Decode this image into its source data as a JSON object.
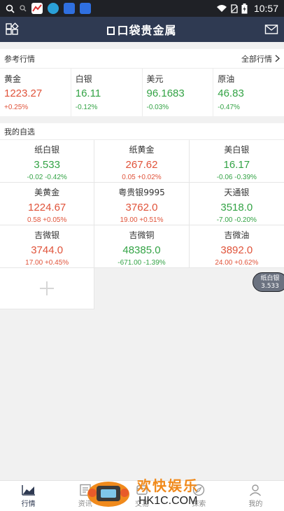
{
  "status_bar": {
    "time": "10:57",
    "left_icons": [
      "search-icon",
      "search-small-icon",
      "stock-app-icon",
      "browser-app-icon",
      "baidu-app-icon",
      "baidu-app-icon"
    ],
    "right_icons": [
      "wifi-icon",
      "no-sim-icon",
      "battery-icon"
    ]
  },
  "app_bar": {
    "title": "口袋贵金属",
    "left_icon": "grid-icon",
    "right_icon": "mail-icon",
    "background": "#2f3a52"
  },
  "reference": {
    "section_title": "参考行情",
    "all_link": "全部行情",
    "items": [
      {
        "name": "黄金",
        "price": "1223.27",
        "change": "+0.25%",
        "direction": "up"
      },
      {
        "name": "白银",
        "price": "16.11",
        "change": "-0.12%",
        "direction": "down"
      },
      {
        "name": "美元",
        "price": "96.1683",
        "change": "-0.03%",
        "direction": "down"
      },
      {
        "name": "原油",
        "price": "46.83",
        "change": "-0.47%",
        "direction": "down"
      }
    ]
  },
  "watchlist": {
    "section_title": "我的自选",
    "rows": [
      [
        {
          "name": "纸白银",
          "price": "3.533",
          "change": "-0.02  -0.42%",
          "direction": "down"
        },
        {
          "name": "纸黄金",
          "price": "267.62",
          "change": "0.05  +0.02%",
          "direction": "up"
        },
        {
          "name": "美白银",
          "price": "16.17",
          "change": "-0.06  -0.39%",
          "direction": "down"
        }
      ],
      [
        {
          "name": "美黄金",
          "price": "1224.67",
          "change": "0.58  +0.05%",
          "direction": "up"
        },
        {
          "name": "粤贵银9995",
          "price": "3762.0",
          "change": "19.00  +0.51%",
          "direction": "up"
        },
        {
          "name": "天通银",
          "price": "3518.0",
          "change": "-7.00  -0.20%",
          "direction": "down"
        }
      ],
      [
        {
          "name": "吉微银",
          "price": "3744.0",
          "change": "17.00  +0.45%",
          "direction": "up"
        },
        {
          "name": "吉微铜",
          "price": "48385.0",
          "change": "-671.00  -1.39%",
          "direction": "down"
        },
        {
          "name": "吉微油",
          "price": "3892.0",
          "change": "24.00  +0.62%",
          "direction": "up"
        }
      ]
    ],
    "add_icon": "plus-icon"
  },
  "floating_ticker": {
    "name": "纸白银",
    "price": "3.533"
  },
  "bottom_nav": [
    {
      "label": "行情",
      "icon": "chart-icon",
      "active": true
    },
    {
      "label": "资讯",
      "icon": "news-icon",
      "active": false
    },
    {
      "label": "交易",
      "icon": "trade-icon",
      "active": false
    },
    {
      "label": "探索",
      "icon": "compass-icon",
      "active": false
    },
    {
      "label": "我的",
      "icon": "user-icon",
      "active": false
    }
  ],
  "watermark": {
    "brand": "欢快娱乐",
    "url": "HK1C.COM"
  },
  "colors": {
    "up": "#e0533a",
    "down": "#33a345",
    "accent": "#2f3a52"
  }
}
